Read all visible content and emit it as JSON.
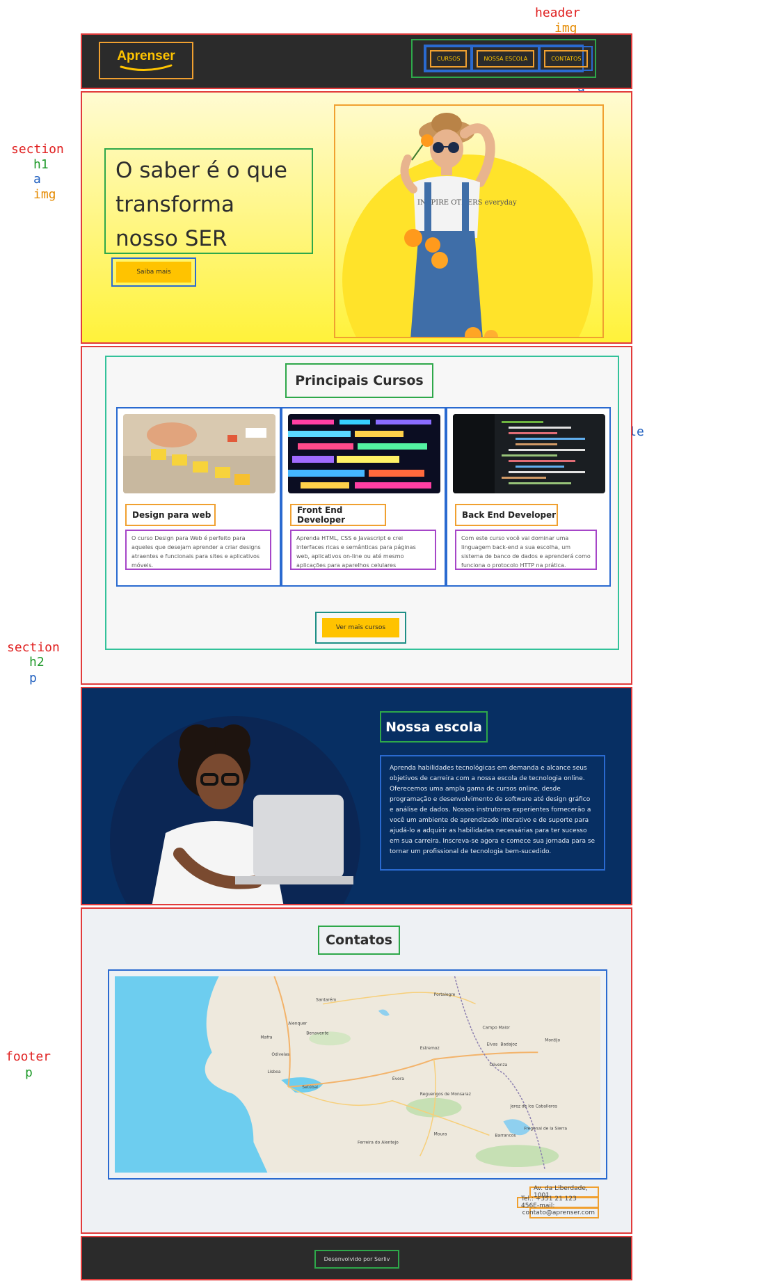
{
  "labels": {
    "header": "header",
    "img": "img",
    "nav": "nav",
    "ul": "ul",
    "li": "li",
    "a": "a",
    "section": "section",
    "h1": "h1",
    "main": "main",
    "h2": "h2",
    "article": "article",
    "h3": "h3",
    "p": "p",
    "iframe": "iframe",
    "footer": "footer"
  },
  "header": {
    "logo": "Aprenser",
    "nav": [
      {
        "label": "CURSOS"
      },
      {
        "label": "NOSSA ESCOLA"
      },
      {
        "label": "CONTATOS"
      }
    ]
  },
  "hero": {
    "title": "O saber é o que transforma nosso SER",
    "cta": "Saiba mais",
    "shirt_text": "INSPIRE OTHERS everyday"
  },
  "cursos": {
    "title": "Principais Cursos",
    "cards": [
      {
        "title": "Design para web",
        "text": "O curso Design para Web é perfeito para aqueles que desejam aprender a criar designs atraentes e funcionais para sites e aplicativos móveis."
      },
      {
        "title": "Front End Developer",
        "text": "Aprenda HTML, CSS e Javascript e crei interfaces ricas e semânticas para páginas web, aplicativos on-line ou até mesmo aplicações para aparelhos celulares"
      },
      {
        "title": "Back End Developer",
        "text": "Com este curso você vai dominar uma linguagem back-end a sua escolha, um sistema de banco de dados e aprenderá como funciona o protocolo HTTP na prática."
      }
    ],
    "cta": "Ver mais cursos"
  },
  "escola": {
    "title": "Nossa escola",
    "text": "Aprenda habilidades tecnológicas em demanda e alcance seus objetivos de carreira com a nossa escola de tecnologia online. Oferecemos uma ampla gama de cursos online, desde programação e desenvolvimento de software até design gráfico e análise de dados. Nossos instrutores experientes fornecerão a você um ambiente de aprendizado interativo e de suporte para ajudá-lo a adquirir as habilidades necessárias para ter sucesso em sua carreira. Inscreva-se agora e comece sua jornada para se tornar um profissional de tecnologia bem-sucedido."
  },
  "contatos": {
    "title": "Contatos",
    "address": "Av. da Liberdade, 1001",
    "phone": "Tel.: +351 21 123 456E-mail:",
    "email": "contato@aprenser.com",
    "map_places": {
      "santarem": "Santarém",
      "portalegre": "Portalegre",
      "alenquer": "Alenquer",
      "benavente": "Benavente",
      "mafra": "Mafra",
      "odivelas": "Odivelas",
      "lisboa": "Lisboa",
      "setubal": "Setúbal",
      "estremoz": "Estremoz",
      "campo_maior": "Campo Maior",
      "elvas": "Elvas",
      "badajoz": "Badajoz",
      "montijo": "Montijo",
      "evora": "Évora",
      "olivenza": "Olivenza",
      "reguengos": "Reguengos de Monsaraz",
      "moura": "Moura",
      "ferreira": "Ferreira do Alentejo",
      "jerez": "Jerez de los Caballeros",
      "fregenal": "Fregenal de la Sierra",
      "barrancos": "Barrancos"
    }
  },
  "footer": {
    "text": "Desenvolvido por Serliv"
  }
}
